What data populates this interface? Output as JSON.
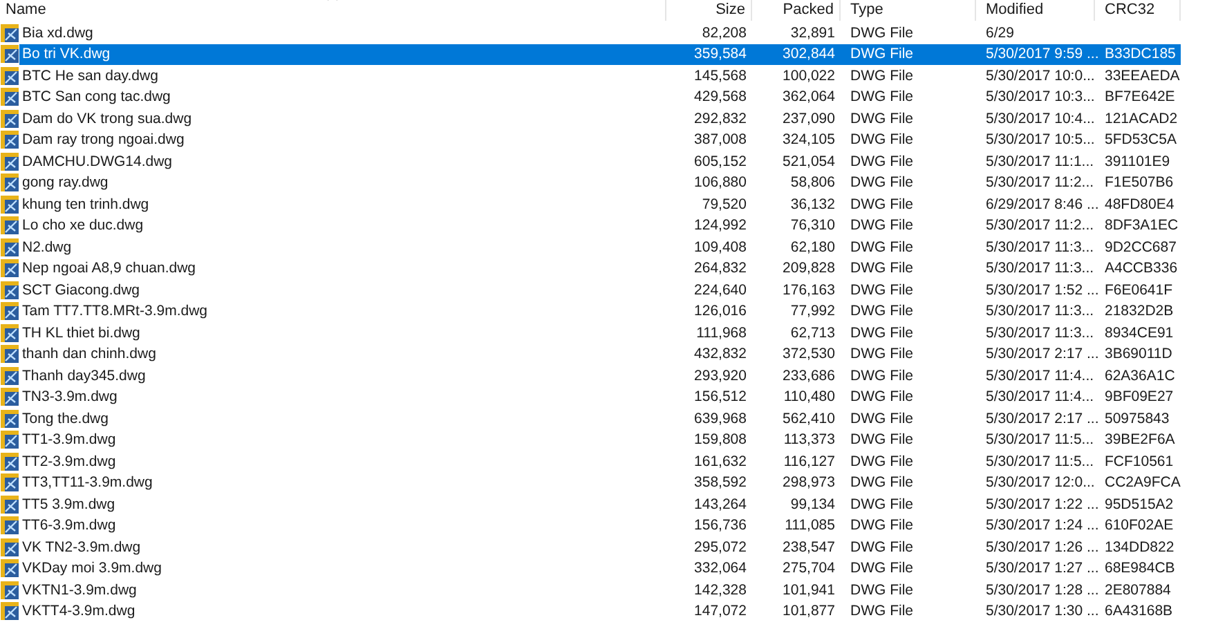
{
  "columns": [
    "Name",
    "Size",
    "Packed",
    "Type",
    "Modified",
    "CRC32"
  ],
  "files": [
    {
      "name": "Bia xd.dwg",
      "size": "82,208",
      "packed": "32,891",
      "type": "DWG File",
      "modified": "6/29",
      "selected": false
    },
    {
      "name": "Bo tri VK.dwg",
      "size": "359,584",
      "packed": "302,844",
      "type": "DWG File",
      "modified": "5/30/2017 9:59 ...",
      "crc": "B33DC185",
      "selected": true
    },
    {
      "name": "BTC He san day.dwg",
      "size": "145,568",
      "packed": "100,022",
      "type": "DWG File",
      "modified": "5/30/2017 10:0...",
      "crc": "33EEAEDA",
      "selected": false
    },
    {
      "name": "BTC San cong tac.dwg",
      "size": "429,568",
      "packed": "362,064",
      "type": "DWG File",
      "modified": "5/30/2017 10:3...",
      "crc": "BF7E642E",
      "selected": false
    },
    {
      "name": "Dam do VK trong sua.dwg",
      "size": "292,832",
      "packed": "237,090",
      "type": "DWG File",
      "modified": "5/30/2017 10:4...",
      "crc": "121ACAD2",
      "selected": false
    },
    {
      "name": "Dam ray trong ngoai.dwg",
      "size": "387,008",
      "packed": "324,105",
      "type": "DWG File",
      "modified": "5/30/2017 10:5...",
      "crc": "5FD53C5A",
      "selected": false
    },
    {
      "name": "DAMCHU.DWG14.dwg",
      "size": "605,152",
      "packed": "521,054",
      "type": "DWG File",
      "modified": "5/30/2017 11:1...",
      "crc": "391101E9",
      "selected": false
    },
    {
      "name": "gong ray.dwg",
      "size": "106,880",
      "packed": "58,806",
      "type": "DWG File",
      "modified": "5/30/2017 11:2...",
      "crc": "F1E507B6",
      "selected": false
    },
    {
      "name": "khung ten trinh.dwg",
      "size": "79,520",
      "packed": "36,132",
      "type": "DWG File",
      "modified": "6/29/2017 8:46 ...",
      "crc": "48FD80E4",
      "selected": false
    },
    {
      "name": "Lo cho xe duc.dwg",
      "size": "124,992",
      "packed": "76,310",
      "type": "DWG File",
      "modified": "5/30/2017 11:2...",
      "crc": "8DF3A1EC",
      "selected": false
    },
    {
      "name": "N2.dwg",
      "size": "109,408",
      "packed": "62,180",
      "type": "DWG File",
      "modified": "5/30/2017 11:3...",
      "crc": "9D2CC687",
      "selected": false
    },
    {
      "name": "Nep ngoai A8,9 chuan.dwg",
      "size": "264,832",
      "packed": "209,828",
      "type": "DWG File",
      "modified": "5/30/2017 11:3...",
      "crc": "A4CCB336",
      "selected": false
    },
    {
      "name": "SCT Giacong.dwg",
      "size": "224,640",
      "packed": "176,163",
      "type": "DWG File",
      "modified": "5/30/2017 1:52 ...",
      "crc": "F6E0641F",
      "selected": false
    },
    {
      "name": "Tam TT7.TT8.MRt-3.9m.dwg",
      "size": "126,016",
      "packed": "77,992",
      "type": "DWG File",
      "modified": "5/30/2017 11:3...",
      "crc": "21832D2B",
      "selected": false
    },
    {
      "name": "TH KL thiet bi.dwg",
      "size": "111,968",
      "packed": "62,713",
      "type": "DWG File",
      "modified": "5/30/2017 11:3...",
      "crc": "8934CE91",
      "selected": false
    },
    {
      "name": "thanh dan chinh.dwg",
      "size": "432,832",
      "packed": "372,530",
      "type": "DWG File",
      "modified": "5/30/2017 2:17 ...",
      "crc": "3B69011D",
      "selected": false
    },
    {
      "name": "Thanh day345.dwg",
      "size": "293,920",
      "packed": "233,686",
      "type": "DWG File",
      "modified": "5/30/2017 11:4...",
      "crc": "62A36A1C",
      "selected": false
    },
    {
      "name": "TN3-3.9m.dwg",
      "size": "156,512",
      "packed": "110,480",
      "type": "DWG File",
      "modified": "5/30/2017 11:4...",
      "crc": "9BF09E27",
      "selected": false
    },
    {
      "name": "Tong the.dwg",
      "size": "639,968",
      "packed": "562,410",
      "type": "DWG File",
      "modified": "5/30/2017 2:17 ...",
      "crc": "50975843",
      "selected": false
    },
    {
      "name": "TT1-3.9m.dwg",
      "size": "159,808",
      "packed": "113,373",
      "type": "DWG File",
      "modified": "5/30/2017 11:5...",
      "crc": "39BE2F6A",
      "selected": false
    },
    {
      "name": "TT2-3.9m.dwg",
      "size": "161,632",
      "packed": "116,127",
      "type": "DWG File",
      "modified": "5/30/2017 11:5...",
      "crc": "FCF10561",
      "selected": false
    },
    {
      "name": "TT3,TT11-3.9m.dwg",
      "size": "358,592",
      "packed": "298,973",
      "type": "DWG File",
      "modified": "5/30/2017 12:0...",
      "crc": "CC2A9FCA",
      "selected": false
    },
    {
      "name": "TT5 3.9m.dwg",
      "size": "143,264",
      "packed": "99,134",
      "type": "DWG File",
      "modified": "5/30/2017 1:22 ...",
      "crc": "95D515A2",
      "selected": false
    },
    {
      "name": "TT6-3.9m.dwg",
      "size": "156,736",
      "packed": "111,085",
      "type": "DWG File",
      "modified": "5/30/2017 1:24 ...",
      "crc": "610F02AE",
      "selected": false
    },
    {
      "name": "VK TN2-3.9m.dwg",
      "size": "295,072",
      "packed": "238,547",
      "type": "DWG File",
      "modified": "5/30/2017 1:26 ...",
      "crc": "134DD822",
      "selected": false
    },
    {
      "name": "VKDay moi 3.9m.dwg",
      "size": "332,064",
      "packed": "275,704",
      "type": "DWG File",
      "modified": "5/30/2017 1:27 ...",
      "crc": "68E984CB",
      "selected": false
    },
    {
      "name": "VKTN1-3.9m.dwg",
      "size": "142,328",
      "packed": "101,941",
      "type": "DWG File",
      "modified": "5/30/2017 1:28 ...",
      "crc": "2E807884",
      "selected": false
    },
    {
      "name": "VKTT4-3.9m.dwg",
      "size": "147,072",
      "packed": "101,877",
      "type": "DWG File",
      "modified": "5/30/2017 1:30 ...",
      "crc": "6A43168B",
      "selected": false
    }
  ]
}
